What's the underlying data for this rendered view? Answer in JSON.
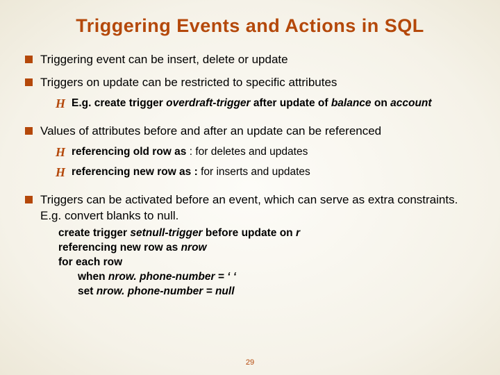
{
  "title": "Triggering Events and Actions in SQL",
  "bullets": {
    "b1": {
      "text": "Triggering event can be insert, delete or update"
    },
    "b2": {
      "text": "Triggers on update can be restricted to specific attributes",
      "sub1_prefix": "E.g.  create trigger ",
      "sub1_italic1": "overdraft-trigger",
      "sub1_mid": " after update of ",
      "sub1_italic2": "balance",
      "sub1_on": " on ",
      "sub1_italic3": "account"
    },
    "b3": {
      "text": "Values of attributes before and after an update can be referenced",
      "sub1_bold": "referencing old row as   ",
      "sub1_rest": ": for deletes and updates",
      "sub2_bold": "referencing new row as  : ",
      "sub2_rest": "for inserts and updates"
    },
    "b4": {
      "text": "Triggers can be activated before an event, which can serve as extra constraints.  E.g. convert blanks to null.",
      "l1a": "create trigger ",
      "l1b": "setnull-trigger",
      "l1c": " before update on ",
      "l1d": "r",
      "l2a": "referencing new row as ",
      "l2b": "nrow",
      "l3": "for each row",
      "l4a": "when ",
      "l4b": "nrow. phone-number",
      "l4c": " = ‘ ‘",
      "l5a": "set ",
      "l5b": "nrow. phone-number",
      "l5c": " = null"
    }
  },
  "pagenum": "29"
}
